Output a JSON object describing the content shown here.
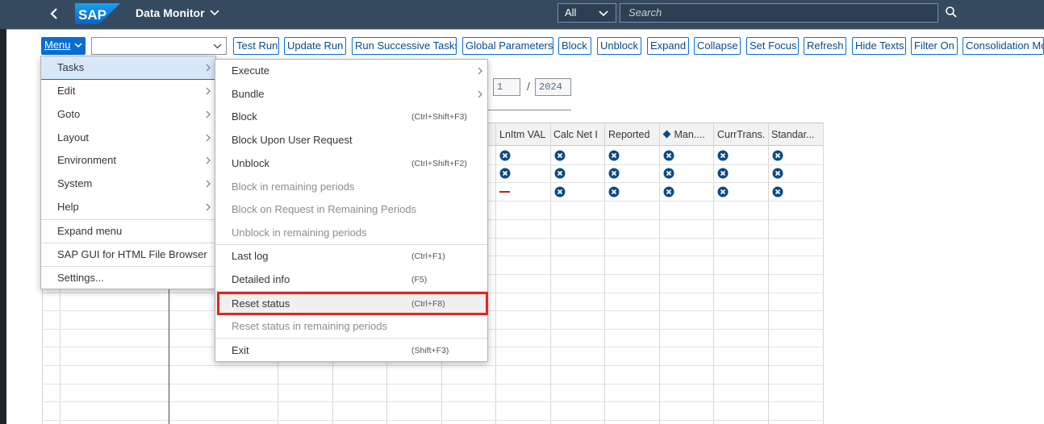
{
  "shell": {
    "title": "Data Monitor",
    "scope": "All",
    "search_placeholder": "Search",
    "logo_text": "SAP"
  },
  "toolbar": {
    "menu_label": "Menu",
    "buttons": [
      "Test Run",
      "Update Run",
      "Run Successive Tasks",
      "Global Parameters",
      "Block",
      "Unblock",
      "Expand",
      "Collapse",
      "Set Focus",
      "Refresh",
      "Hide Texts",
      "Filter On",
      "Consolidation Mo"
    ]
  },
  "period": {
    "period": "1",
    "year": "2024"
  },
  "grid": {
    "columns": [
      "LnItm VAL",
      "Calc Net I",
      "Reported",
      "Man....",
      "CurrTrans.",
      "Standar..."
    ]
  },
  "main_menu": {
    "items": [
      {
        "label": "Tasks"
      },
      {
        "label": "Edit"
      },
      {
        "label": "Goto"
      },
      {
        "label": "Layout"
      },
      {
        "label": "Environment"
      },
      {
        "label": "System"
      },
      {
        "label": "Help"
      },
      {
        "label": "Expand menu"
      },
      {
        "label": "SAP GUI for HTML File Browser"
      },
      {
        "label": "Settings..."
      }
    ]
  },
  "tasks_menu": {
    "items": [
      {
        "label": "Execute",
        "shortcut": ""
      },
      {
        "label": "Bundle",
        "shortcut": ""
      },
      {
        "label": "Block",
        "shortcut": "(Ctrl+Shift+F3)"
      },
      {
        "label": "Block Upon User Request",
        "shortcut": ""
      },
      {
        "label": "Unblock",
        "shortcut": "(Ctrl+Shift+F2)"
      },
      {
        "label": "Block in remaining periods",
        "shortcut": ""
      },
      {
        "label": "Block on Request in Remaining Periods",
        "shortcut": ""
      },
      {
        "label": "Unblock in remaining periods",
        "shortcut": ""
      },
      {
        "label": "Last log",
        "shortcut": "(Ctrl+F1)"
      },
      {
        "label": "Detailed info",
        "shortcut": "(F5)"
      },
      {
        "label": "Reset status",
        "shortcut": "(Ctrl+F8)"
      },
      {
        "label": "Reset status in remaining periods",
        "shortcut": ""
      },
      {
        "label": "Exit",
        "shortcut": "(Shift+F3)"
      }
    ]
  },
  "colors": {
    "shell": "#354a5f",
    "accent": "#0a6ed1",
    "status_x": "#0a4a88",
    "dash": "#c0201b",
    "highlight": "#e3251e"
  }
}
